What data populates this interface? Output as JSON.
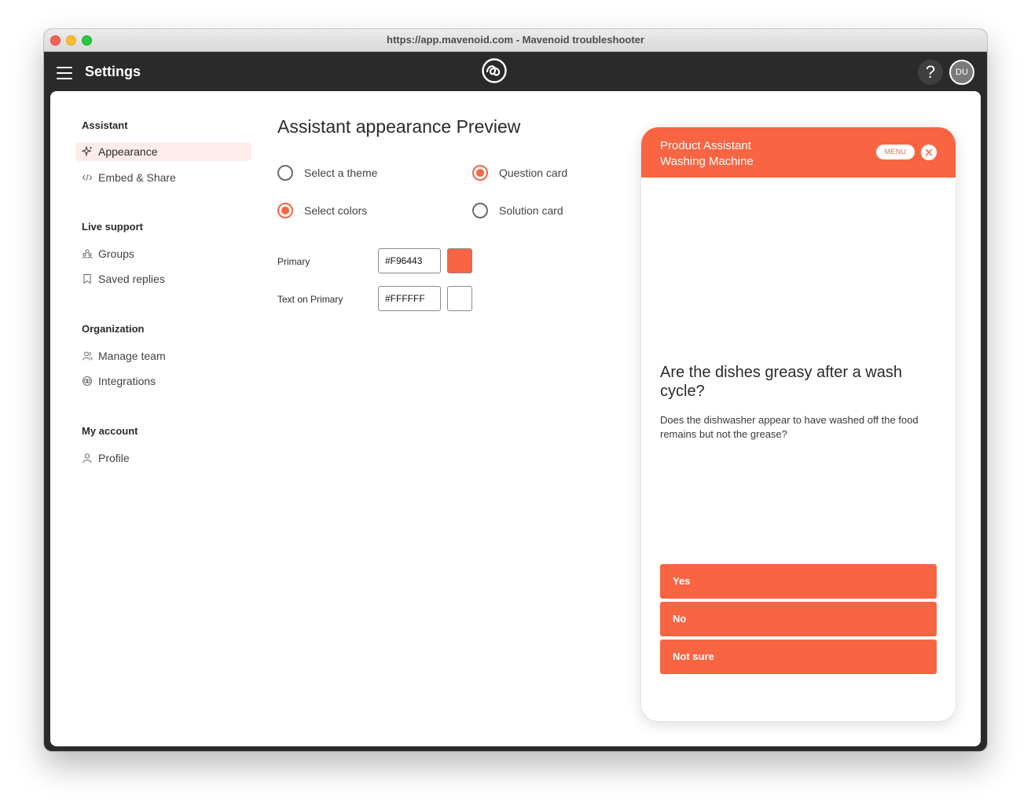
{
  "browser": {
    "window_title": "https://app.mavenoid.com - Mavenoid troubleshooter"
  },
  "appbar": {
    "title": "Settings",
    "help_label": "?",
    "avatar_initials": "DU"
  },
  "sidebar": {
    "sections": [
      {
        "title": "Assistant",
        "items": [
          {
            "label": "Appearance",
            "icon": "sparkle-icon",
            "active": true
          },
          {
            "label": "Embed & Share",
            "icon": "code-icon",
            "active": false
          }
        ]
      },
      {
        "title": "Live support",
        "items": [
          {
            "label": "Groups",
            "icon": "groups-icon",
            "active": false
          },
          {
            "label": "Saved replies",
            "icon": "bookmark-icon",
            "active": false
          }
        ]
      },
      {
        "title": "Organization",
        "items": [
          {
            "label": "Manage team",
            "icon": "team-icon",
            "active": false
          },
          {
            "label": "Integrations",
            "icon": "integrations-icon",
            "active": false
          }
        ]
      },
      {
        "title": "My account",
        "items": [
          {
            "label": "Profile",
            "icon": "person-icon",
            "active": false
          }
        ]
      }
    ]
  },
  "main": {
    "title": "Assistant appearance",
    "preview_title": "Preview",
    "options": {
      "select_theme": {
        "label": "Select a theme",
        "checked": false
      },
      "select_colors": {
        "label": "Select colors",
        "checked": true
      },
      "question_card": {
        "label": "Question card",
        "checked": true
      },
      "solution_card": {
        "label": "Solution card",
        "checked": false
      }
    },
    "colors": {
      "primary": {
        "label": "Primary",
        "value": "#F96443"
      },
      "text_on_primary": {
        "label": "Text on Primary",
        "value": "#FFFFFF"
      }
    }
  },
  "preview": {
    "header_line1": "Product Assistant",
    "header_line2": "Washing Machine",
    "menu_label": "MENU",
    "question": "Are the dishes greasy after a wash cycle?",
    "description": "Does the dishwasher appear to have washed off the food remains but not the grease?",
    "answers": [
      "Yes",
      "No",
      "Not sure"
    ]
  },
  "theme": {
    "accent": "#F96443",
    "on_accent": "#FFFFFF",
    "appbar": "#2A2A2A"
  }
}
